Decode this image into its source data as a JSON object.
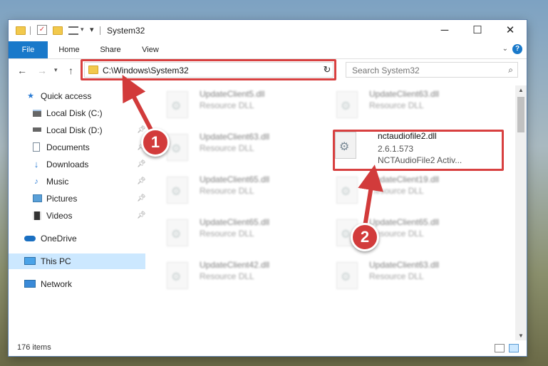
{
  "window": {
    "title": "System32",
    "controls": {
      "minimize": "─",
      "maximize": "☐",
      "close": "✕"
    }
  },
  "ribbon": {
    "tabs": [
      "File",
      "Home",
      "Share",
      "View"
    ],
    "help": "?"
  },
  "address": {
    "path": "C:\\Windows\\System32",
    "search_placeholder": "Search System32"
  },
  "sidebar": {
    "items": [
      {
        "label": "Quick access",
        "icon": "star-icon"
      },
      {
        "label": "Local Disk (C:)",
        "icon": "drive-icon"
      },
      {
        "label": "Local Disk (D:)",
        "icon": "drive-icon"
      },
      {
        "label": "Documents",
        "icon": "documents-icon"
      },
      {
        "label": "Downloads",
        "icon": "download-icon"
      },
      {
        "label": "Music",
        "icon": "music-icon"
      },
      {
        "label": "Pictures",
        "icon": "pictures-icon"
      },
      {
        "label": "Videos",
        "icon": "videos-icon"
      },
      {
        "label": "OneDrive",
        "icon": "cloud-icon"
      },
      {
        "label": "This PC",
        "icon": "computer-icon"
      },
      {
        "label": "Network",
        "icon": "network-icon"
      }
    ]
  },
  "files": [
    {
      "name": "UpdateClient5.dll",
      "type": "Resource DLL"
    },
    {
      "name": "UpdateClient63.dll",
      "type": "Resource DLL"
    },
    {
      "name": "UpdateClient63.dll",
      "type": "Resource DLL"
    },
    {
      "name": "nctaudiofile2.dll",
      "version": "2.6.1.573",
      "desc": "NCTAudioFile2 Activ..."
    },
    {
      "name": "UpdateClient65.dll",
      "type": "Resource DLL"
    },
    {
      "name": "UpdateClient19.dll",
      "type": "Resource DLL"
    },
    {
      "name": "UpdateClient65.dll",
      "type": "Resource DLL"
    },
    {
      "name": "UpdateClient65.dll",
      "type": "Resource DLL"
    },
    {
      "name": "UpdateClient42.dll",
      "type": "Resource DLL"
    },
    {
      "name": "UpdateClient63.dll",
      "type": "Resource DLL"
    }
  ],
  "status": {
    "items": "176 items"
  },
  "annotations": {
    "step1": "1",
    "step2": "2"
  },
  "colors": {
    "accent": "#1979ca",
    "highlight": "#d84040",
    "selected": "#cce8ff"
  }
}
